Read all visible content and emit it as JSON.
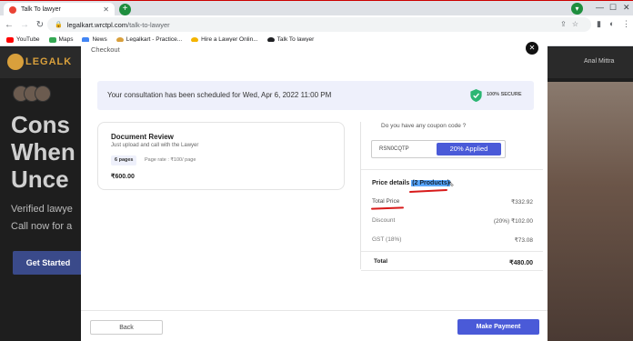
{
  "browser": {
    "tab_title": "Talk To lawyer",
    "url_host": "legalkart.wrctpl.com",
    "url_path": "/talk-to-lawyer",
    "bookmarks": [
      {
        "label": "YouTube",
        "icon": "youtube-icon",
        "color": "#ff0000"
      },
      {
        "label": "Maps",
        "icon": "maps-icon",
        "color": "#34a853"
      },
      {
        "label": "News",
        "icon": "news-icon",
        "color": "#4285f4"
      },
      {
        "label": "Legalkart - Practice...",
        "icon": "legalkart-icon",
        "color": "#d9a03c"
      },
      {
        "label": "Hire a Lawyer Onlin...",
        "icon": "hire-lawyer-icon",
        "color": "#f4b400"
      },
      {
        "label": "Talk To lawyer",
        "icon": "globe-icon",
        "color": "#202124"
      }
    ]
  },
  "background": {
    "logo_text": "LEGALK",
    "user_name": "Anal Mittra",
    "hero_lines": [
      "Cons",
      "When",
      "Unce"
    ],
    "sub_lines": [
      "Verified lawye",
      "Call now for a"
    ],
    "cta_label": "Get Started"
  },
  "modal": {
    "title": "Checkout",
    "banner_text": "Your consultation has been scheduled for Wed, Apr 6, 2022 11:00 PM",
    "secure_label": "100% SECURE",
    "product": {
      "title": "Document Review",
      "subtitle": "Just upload and call with the Lawyer",
      "pages": "6 pages",
      "page_rate": "Page rate : ₹100/ page",
      "price": "₹600.00"
    },
    "coupon": {
      "question": "Do you have any coupon code ?",
      "code": "RSN0CQTP",
      "applied_label": "20% Applied"
    },
    "price_details": {
      "label": "Price details",
      "count": "(2 Products)",
      "rows": [
        {
          "label": "Total Price",
          "value": "₹332.92"
        },
        {
          "label": "Discount",
          "value": "(20%) ₹102.00"
        },
        {
          "label": "GST (18%)",
          "value": "₹73.08"
        }
      ],
      "total_label": "Total",
      "total_value": "₹480.00"
    },
    "back_label": "Back",
    "pay_label": "Make Payment"
  },
  "colors": {
    "accent": "#4a5ad8",
    "secure_green": "#2bb673",
    "annotation_red": "#d81a1a"
  }
}
